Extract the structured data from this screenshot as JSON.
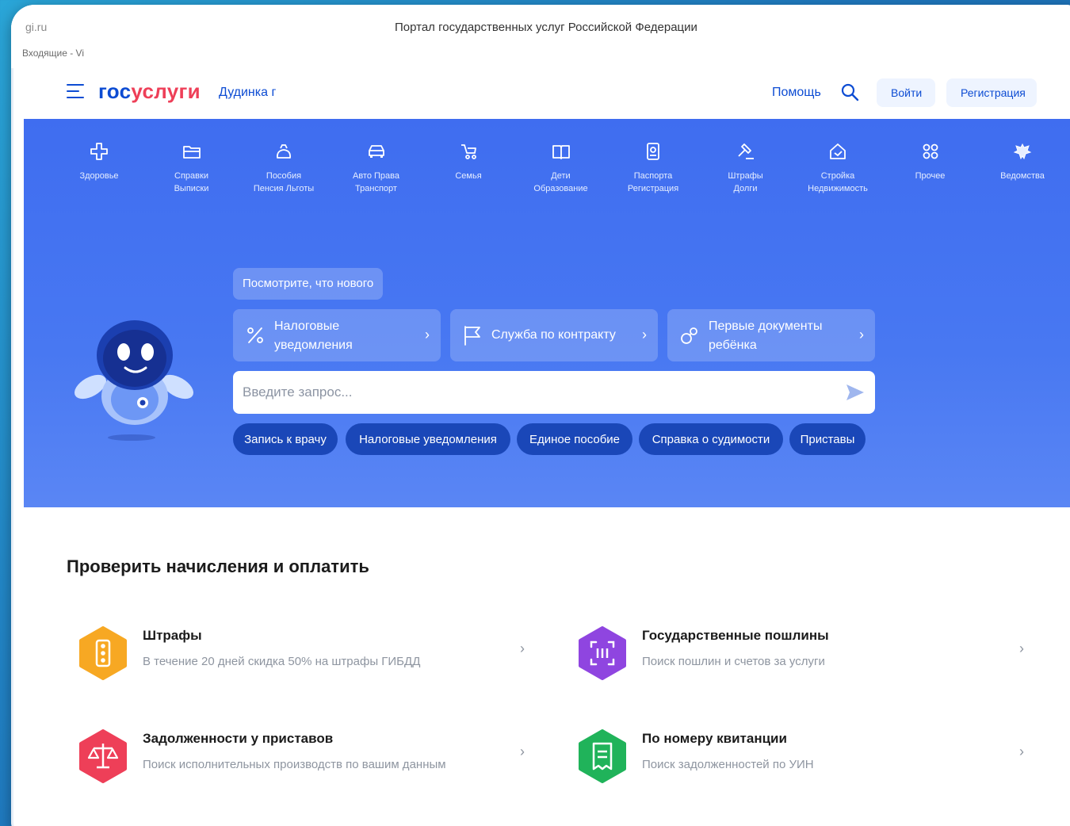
{
  "browser": {
    "url": "gi.ru",
    "title": "Портал государственных услуг Российской Федерации",
    "tab": "Входящие - Vi"
  },
  "header": {
    "logo_part1": "гос",
    "logo_part2": "услуги",
    "city": "Дудинка г",
    "help": "Помощь",
    "login": "Войти",
    "register": "Регистрация"
  },
  "categories": [
    {
      "l1": "Здоровье",
      "l2": "",
      "icon": "plus-icon"
    },
    {
      "l1": "Справки",
      "l2": "Выписки",
      "icon": "folder-icon"
    },
    {
      "l1": "Пособия",
      "l2": "Пенсия Льготы",
      "icon": "bag-icon"
    },
    {
      "l1": "Авто Права",
      "l2": "Транспорт",
      "icon": "car-icon"
    },
    {
      "l1": "Семья",
      "l2": "",
      "icon": "stroller-icon"
    },
    {
      "l1": "Дети",
      "l2": "Образование",
      "icon": "book-icon"
    },
    {
      "l1": "Паспорта",
      "l2": "Регистрация",
      "icon": "passport-icon"
    },
    {
      "l1": "Штрафы",
      "l2": "Долги",
      "icon": "gavel-icon"
    },
    {
      "l1": "Стройка",
      "l2": "Недвижимость",
      "icon": "house-icon"
    },
    {
      "l1": "Прочее",
      "l2": "",
      "icon": "grid-icon"
    },
    {
      "l1": "Ведомства",
      "l2": "",
      "icon": "eagle-icon"
    }
  ],
  "hero": {
    "whats_new": "Посмотрите, что нового",
    "promos": [
      {
        "line1": "Налоговые",
        "line2": "уведомления",
        "icon": "percent-icon"
      },
      {
        "line1": "Служба по контракту",
        "line2": "",
        "icon": "flag-icon"
      },
      {
        "line1": "Первые документы",
        "line2": "ребёнка",
        "icon": "pacifier-icon"
      }
    ],
    "search_placeholder": "Введите запрос...",
    "chips": [
      "Запись к врачу",
      "Налоговые уведомления",
      "Единое пособие",
      "Справка о судимости",
      "Приставы"
    ]
  },
  "payments": {
    "title": "Проверить начисления и оплатить",
    "items": [
      {
        "title": "Штрафы",
        "subtitle": "В течение 20 дней скидка 50% на штрафы ГИБДД",
        "color": "#f7a823",
        "icon": "traffic-light-icon"
      },
      {
        "title": "Государственные пошлины",
        "subtitle": "Поиск пошлин и счетов за услуги",
        "color": "#8f45e0",
        "icon": "scan-icon"
      },
      {
        "title": "Задолженности у приставов",
        "subtitle": "Поиск исполнительных производств по вашим данным",
        "color": "#ee3f58",
        "icon": "scales-icon"
      },
      {
        "title": "По номеру квитанции",
        "subtitle": "Поиск задолженностей по УИН",
        "color": "#20b35a",
        "icon": "receipt-icon"
      }
    ]
  },
  "colors": {
    "brand_blue": "#0d4cd3",
    "brand_red": "#ee3f58",
    "hero_blue": "#4878f2",
    "chip_blue": "#1a47b8"
  }
}
